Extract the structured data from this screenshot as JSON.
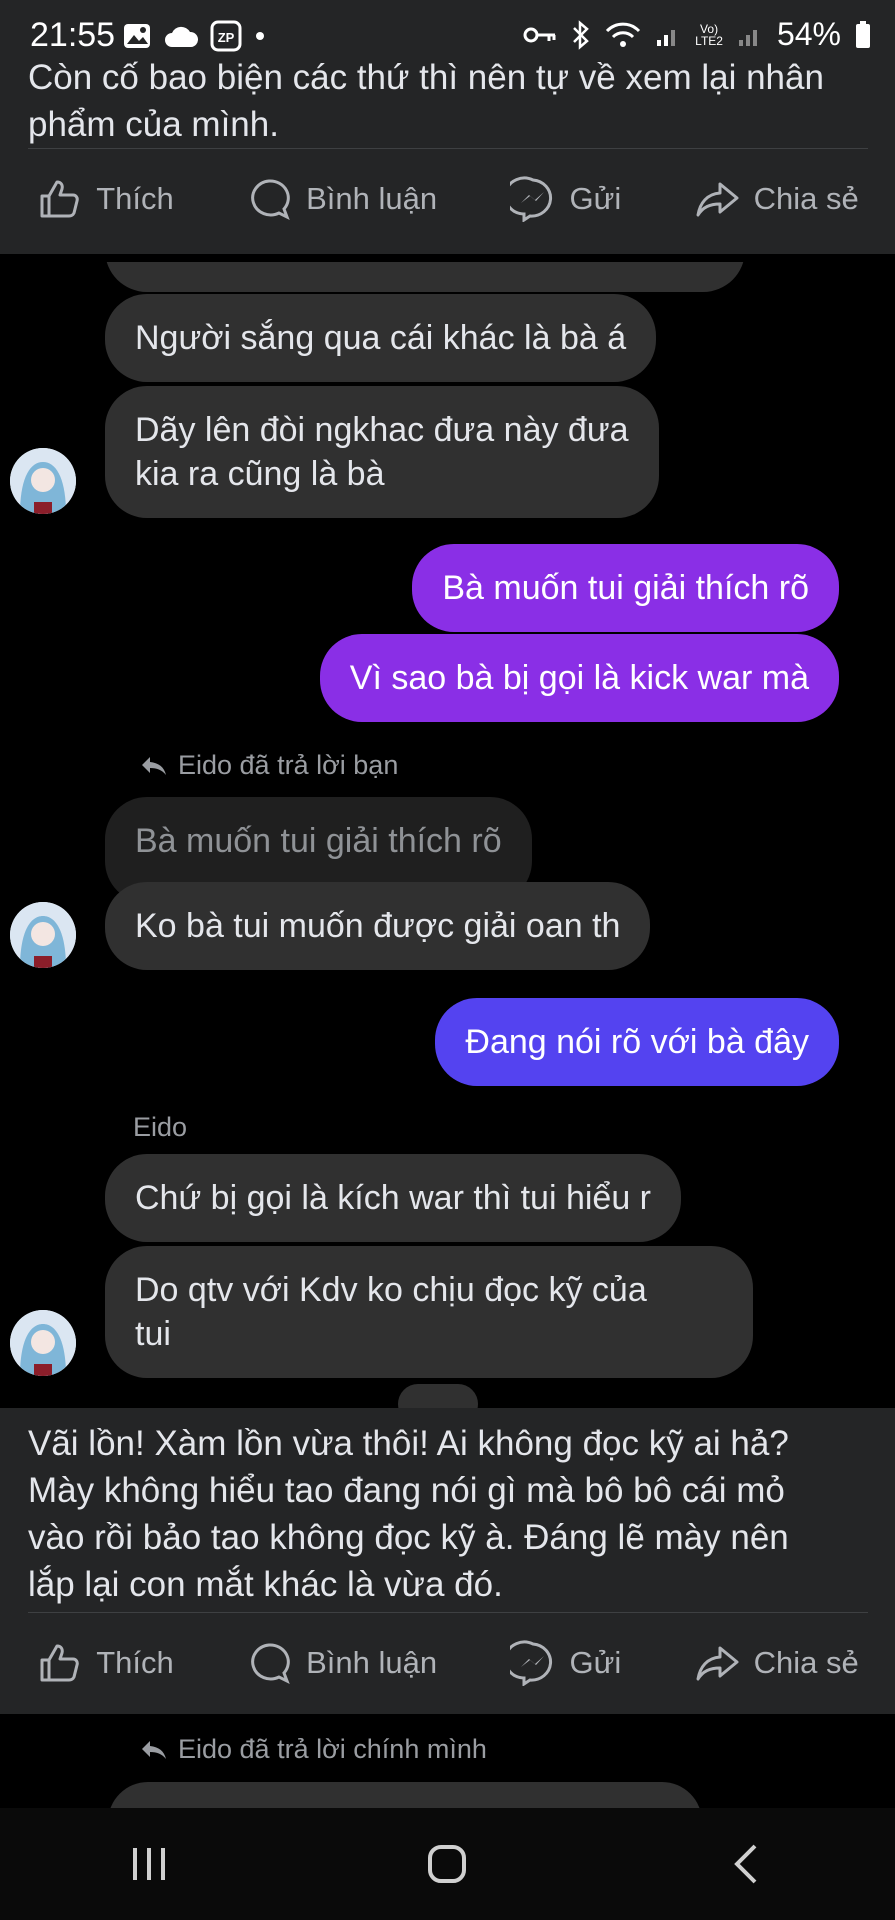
{
  "status_bar": {
    "time": "21:55",
    "battery": "54%",
    "network_label_top": "Vo)",
    "network_label_bottom": "LTE2"
  },
  "post1": {
    "text_line1": "Còn cố bao biện các thứ thì nên tự về xem lại nhân",
    "text_line2": "phẩm của mình."
  },
  "actions": {
    "like": "Thích",
    "comment": "Bình luận",
    "send": "Gửi",
    "share": "Chia sẻ"
  },
  "chat": {
    "msg1": "Người sắng qua cái khác là bà á",
    "msg2_line1": "Dãy lên đòi ngkhac đưa này đưa",
    "msg2_line2": "kia ra cũng là bà",
    "out1": "Bà muốn tui giải thích rõ",
    "out2": "Vì sao bà bị gọi là kick war mà",
    "reply_meta1": "Eido đã trả lời bạn",
    "quoted1": "Bà muốn tui giải thích rõ",
    "msg3": "Ko bà tui muốn được giải oan th",
    "out3": "Đang nói rõ với bà đây",
    "sender_name": "Eido",
    "msg4": "Chứ bị gọi là kích war thì tui hiểu r",
    "msg5_line1": "Do qtv với Kdv ko chịu đọc kỹ của",
    "msg5_line2": "tui"
  },
  "post2": {
    "line1": "Vãi lồn! Xàm lồn vừa thôi! Ai không đọc kỹ ai hả?",
    "line2": "Mày không hiểu tao đang nói gì mà bô bô cái mỏ",
    "line3": "vào rồi bảo tao không đọc kỹ à. Đáng lẽ mày nên",
    "line4": "lắp lại con mắt khác là vừa đó."
  },
  "chat2": {
    "reply_meta2": "Eido đã trả lời chính mình"
  },
  "colors": {
    "panel": "#242526",
    "incoming_bubble": "#303030",
    "outgoing_purple": "#8a2fe6",
    "outgoing_blue": "#5443f0"
  },
  "icons": [
    "image-icon",
    "cloud-icon",
    "zalo-icon",
    "key-icon",
    "bluetooth-icon",
    "wifi-icon",
    "signal-icon",
    "battery-icon",
    "like-icon",
    "comment-icon",
    "messenger-icon",
    "share-icon",
    "reply-icon",
    "recent-apps-icon",
    "home-icon",
    "back-icon"
  ]
}
